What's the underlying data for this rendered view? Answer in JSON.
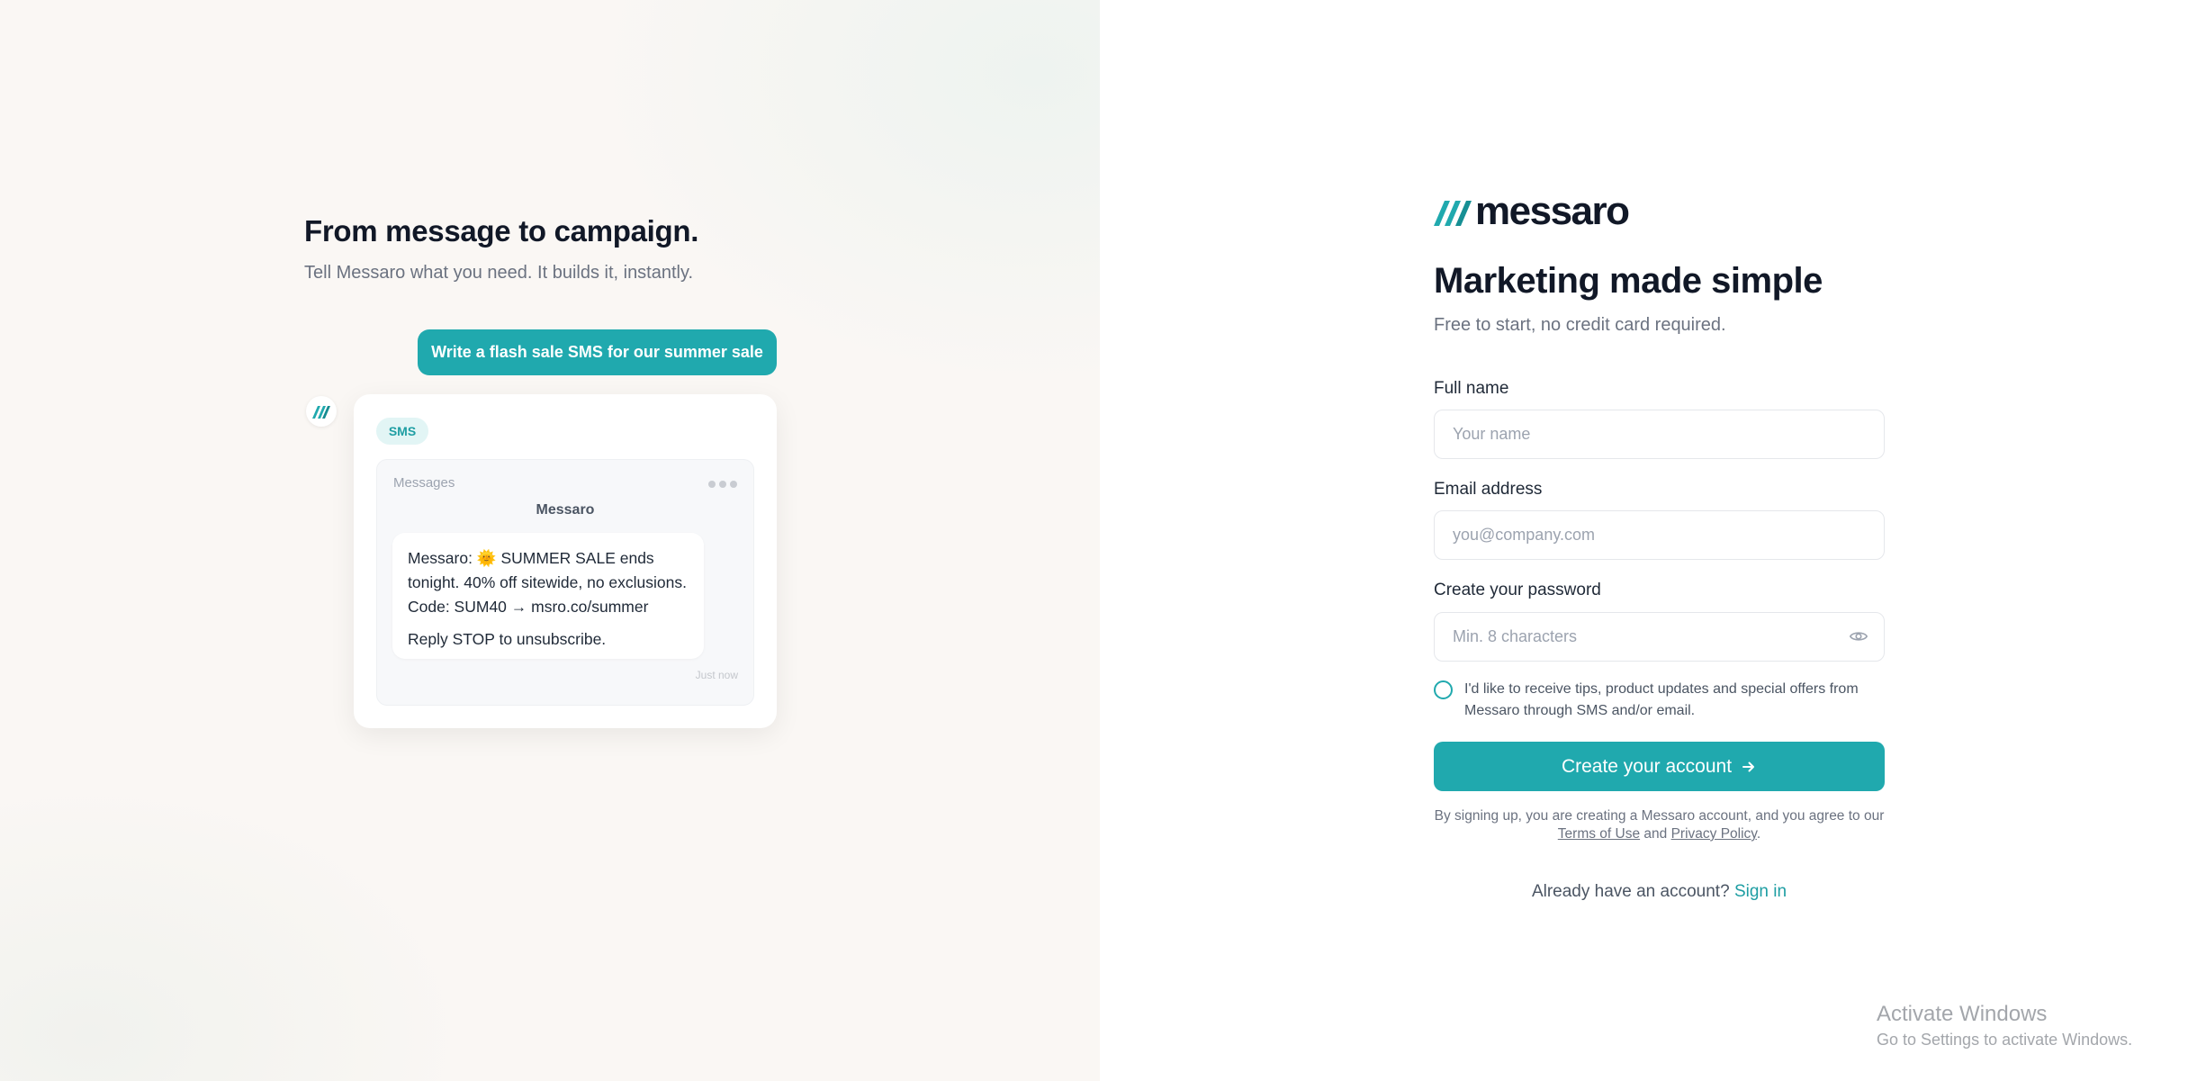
{
  "colors": {
    "accent": "#20a9ae",
    "heading": "#111827",
    "muted": "#6b7280"
  },
  "hero": {
    "title": "From message to campaign.",
    "subtitle": "Tell Messaro what you need. It builds it, instantly.",
    "prompt": "Write a flash sale SMS for our summer sale",
    "card": {
      "badge": "SMS",
      "header_label": "Messages",
      "contact": "Messaro",
      "message_line1": "Messaro: 🌞 SUMMER SALE ends tonight. 40% off sitewide, no exclusions. Code: SUM40 → msro.co/summer",
      "message_line2": "Reply STOP to unsubscribe.",
      "timestamp": "Just now"
    }
  },
  "brand": {
    "name": "messaro"
  },
  "form": {
    "headline": "Marketing made simple",
    "tagline": "Free to start, no credit card required.",
    "fields": {
      "name": {
        "label": "Full name",
        "placeholder": "Your name",
        "value": ""
      },
      "email": {
        "label": "Email address",
        "placeholder": "you@company.com",
        "value": ""
      },
      "password": {
        "label": "Create your password",
        "placeholder": "Min. 8 characters",
        "value": ""
      }
    },
    "consent": "I'd like to receive tips, product updates and special offers from Messaro through SMS and/or email.",
    "submit_label": "Create your account",
    "legal": {
      "prefix": "By signing up, you are creating a Messaro account, and you agree to our ",
      "terms": "Terms of Use",
      "and": " and ",
      "privacy": "Privacy Policy",
      "suffix": "."
    },
    "signin": {
      "prompt": "Already have an account?",
      "link": "Sign in"
    }
  },
  "os_watermark": {
    "title": "Activate Windows",
    "subtitle": "Go to Settings to activate Windows."
  }
}
